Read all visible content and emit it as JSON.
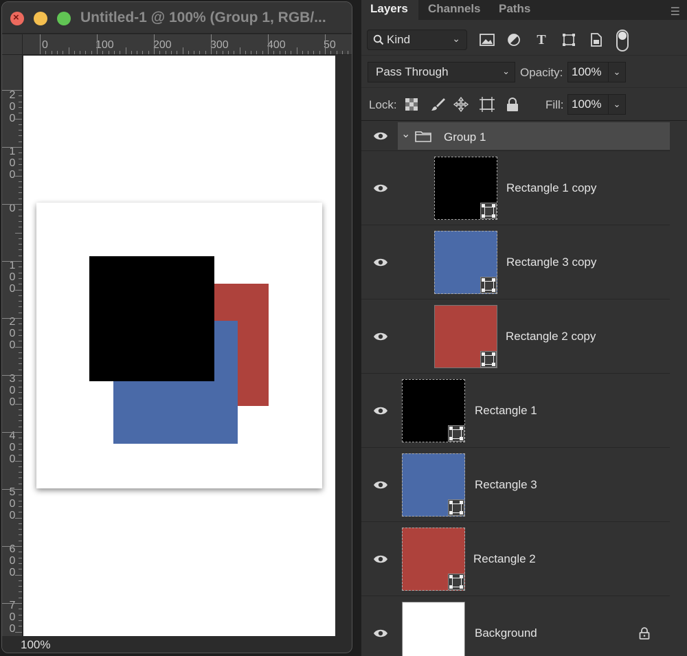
{
  "document": {
    "title": "Untitled-1 @ 100% (Group 1, RGB/...",
    "zoom": "100%",
    "ruler_h_labels": [
      "0",
      "100",
      "200",
      "300",
      "400",
      "50"
    ],
    "ruler_v_labels": [
      "200",
      "100",
      "0",
      "100",
      "200",
      "300",
      "400",
      "500",
      "600",
      "700"
    ],
    "canvas_shapes": [
      {
        "name": "Rectangle 2",
        "color": "#ae423c"
      },
      {
        "name": "Rectangle 3",
        "color": "#4a6aa8"
      },
      {
        "name": "Rectangle 1",
        "color": "#000000"
      }
    ]
  },
  "panel": {
    "tabs": [
      {
        "label": "Layers",
        "active": true
      },
      {
        "label": "Channels",
        "active": false
      },
      {
        "label": "Paths",
        "active": false
      }
    ],
    "filter": {
      "label": "Kind",
      "icons": [
        "image-filter-icon",
        "adjustment-filter-icon",
        "type-filter-icon",
        "shape-filter-icon",
        "smart-object-filter-icon"
      ]
    },
    "blend_mode": "Pass Through",
    "opacity_label": "Opacity:",
    "opacity": "100%",
    "lock_label": "Lock:",
    "fill_label": "Fill:",
    "fill": "100%"
  },
  "layers": [
    {
      "name": "Group 1",
      "type": "group",
      "expanded": true,
      "visible": true,
      "selected": true
    },
    {
      "name": "Rectangle 1 copy",
      "type": "shape",
      "color": "#000000",
      "visible": true
    },
    {
      "name": "Rectangle 3 copy",
      "type": "shape",
      "color": "#4a6aa8",
      "visible": true
    },
    {
      "name": "Rectangle 2 copy",
      "type": "shape",
      "color": "#ae423c",
      "visible": true
    },
    {
      "name": "Rectangle 1",
      "type": "shape",
      "color": "#000000",
      "visible": true
    },
    {
      "name": "Rectangle 3",
      "type": "shape",
      "color": "#4a6aa8",
      "visible": true
    },
    {
      "name": "Rectangle 2",
      "type": "shape",
      "color": "#ae423c",
      "visible": true
    },
    {
      "name": "Background",
      "type": "background",
      "color": "#ffffff",
      "visible": true,
      "locked": true
    }
  ]
}
